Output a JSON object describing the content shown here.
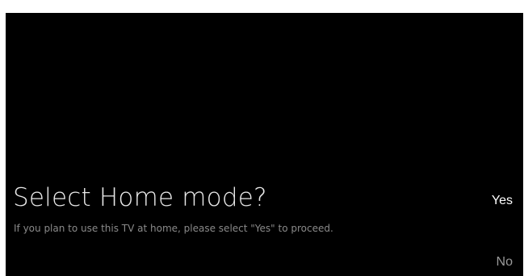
{
  "dialog": {
    "title": "Select Home mode?",
    "description": "If you plan to use this TV at home, please select \"Yes\" to proceed.",
    "options": [
      {
        "label": "Yes",
        "focused": true
      },
      {
        "label": "No",
        "focused": false
      }
    ]
  },
  "colors": {
    "background": "#000000",
    "title": "#e9e9e9",
    "description": "#8a8a8a",
    "option_focused": "#ffffff",
    "option_unfocused": "#9a9a9a"
  }
}
